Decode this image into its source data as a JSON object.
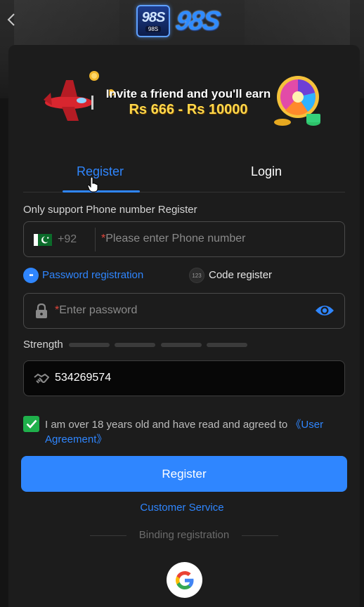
{
  "header": {
    "logo_badge_text": "98S",
    "logo_badge_sub": "98S",
    "logo_text": "98S"
  },
  "banner": {
    "line1": "Invite a friend and you'll earn",
    "line2": "Rs 666 - Rs 10000"
  },
  "tabs": [
    {
      "label": "Register",
      "active": true
    },
    {
      "label": "Login",
      "active": false
    }
  ],
  "form": {
    "hint": "Only support Phone number Register",
    "phone": {
      "prefix": "+92",
      "required_mark": "*",
      "placeholder": "Please enter Phone number",
      "value": ""
    },
    "modes": [
      {
        "label": "Password registration",
        "selected": true,
        "icon_text": "••"
      },
      {
        "label": "Code register",
        "selected": false,
        "icon_text": "123"
      }
    ],
    "password": {
      "required_mark": "*",
      "placeholder": "Enter password",
      "value": ""
    },
    "strength": {
      "label": "Strength",
      "level": 0,
      "segments": 4
    },
    "invite_code": {
      "value": "534269574"
    },
    "agreement": {
      "checked": true,
      "text": "I am over 18 years old and have read and agreed to ",
      "link": "《User Agreement》"
    },
    "submit_label": "Register"
  },
  "footer": {
    "customer_service": "Customer Service",
    "binding_label": "Binding registration"
  },
  "colors": {
    "accent": "#2f86ff",
    "check_green": "#1fb04b",
    "required_red": "#e0463b",
    "banner_gold": "#ffd84a"
  }
}
